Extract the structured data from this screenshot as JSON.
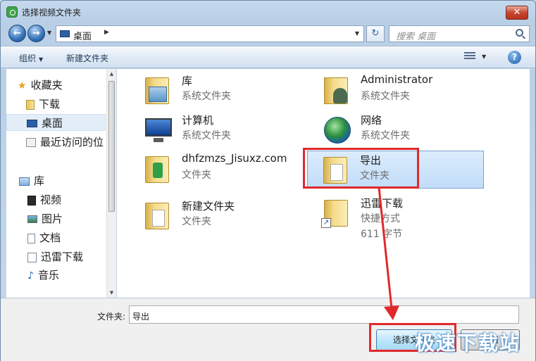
{
  "window": {
    "title": "选择视频文件夹",
    "close_label": "✕"
  },
  "address": {
    "crumb": "桌面",
    "search_placeholder": "搜索 桌面"
  },
  "toolbar": {
    "organize": "组织",
    "new_folder": "新建文件夹",
    "help": "?"
  },
  "sidebar": {
    "items": [
      {
        "label": "收藏夹",
        "icon": "star-icon"
      },
      {
        "label": "下载",
        "icon": "folder-icon"
      },
      {
        "label": "桌面",
        "icon": "desktop-icon",
        "selected": true
      },
      {
        "label": "最近访问的位",
        "icon": "recent-places-icon"
      },
      {
        "label": "库",
        "icon": "library-icon"
      },
      {
        "label": "视频",
        "icon": "video-library-icon"
      },
      {
        "label": "图片",
        "icon": "pictures-library-icon"
      },
      {
        "label": "文档",
        "icon": "documents-library-icon"
      },
      {
        "label": "迅雷下载",
        "icon": "xunlei-folder-icon"
      },
      {
        "label": "音乐",
        "icon": "music-library-icon"
      }
    ]
  },
  "files": [
    {
      "name": "库",
      "type": "系统文件夹",
      "icon": "libraries-folder-icon"
    },
    {
      "name": "Administrator",
      "type": "系统文件夹",
      "icon": "user-folder-icon"
    },
    {
      "name": "计算机",
      "type": "系统文件夹",
      "icon": "computer-icon"
    },
    {
      "name": "网络",
      "type": "系统文件夹",
      "icon": "network-globe-icon"
    },
    {
      "name": "dhfzmzs_Jisuxz.com",
      "type": "文件夹",
      "icon": "green-folder-icon"
    },
    {
      "name": "导出",
      "type": "文件夹",
      "icon": "folder-icon",
      "selected": true
    },
    {
      "name": "新建文件夹",
      "type": "文件夹",
      "icon": "folder-icon"
    },
    {
      "name": "迅雷下载",
      "type": "快捷方式",
      "size": "611 字节",
      "icon": "shortcut-folder-icon"
    }
  ],
  "bottom": {
    "folder_label": "文件夹:",
    "folder_value": "导出",
    "select_button": "选择文件夹",
    "cancel_button": "取消"
  },
  "watermark": "极速下载站",
  "colors": {
    "highlight": "#e1292b",
    "selection": "#c1dcf9"
  }
}
